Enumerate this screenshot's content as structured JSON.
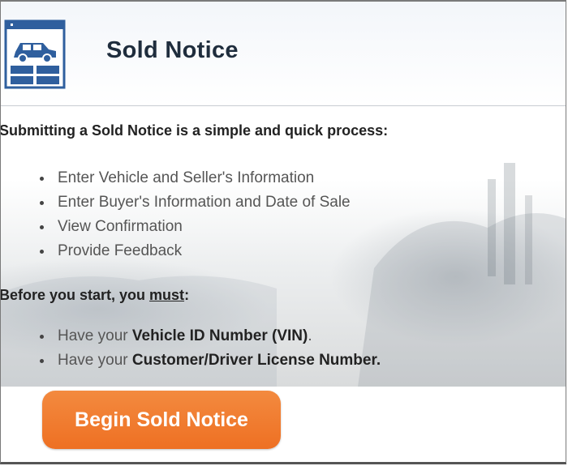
{
  "header": {
    "title": "Sold Notice",
    "icon": "vehicle-form-icon"
  },
  "intro": "Submitting a Sold Notice is a simple and quick process:",
  "steps": [
    "Enter Vehicle and Seller's Information",
    "Enter Buyer's Information and Date of Sale",
    "View Confirmation",
    "Provide Feedback"
  ],
  "requirements": {
    "lead_before": "Before you start, you ",
    "lead_must": "must",
    "lead_after": ":",
    "items": [
      {
        "prefix": "Have your ",
        "bold": "Vehicle ID Number (VIN)",
        "suffix": "."
      },
      {
        "prefix": "Have your ",
        "bold": "Customer/Driver License Number.",
        "suffix": ""
      }
    ]
  },
  "cta": {
    "label": "Begin Sold Notice",
    "color": "#ef7528"
  },
  "colors": {
    "icon_blue": "#2f5f9e",
    "title_text": "#1f2d3d"
  }
}
